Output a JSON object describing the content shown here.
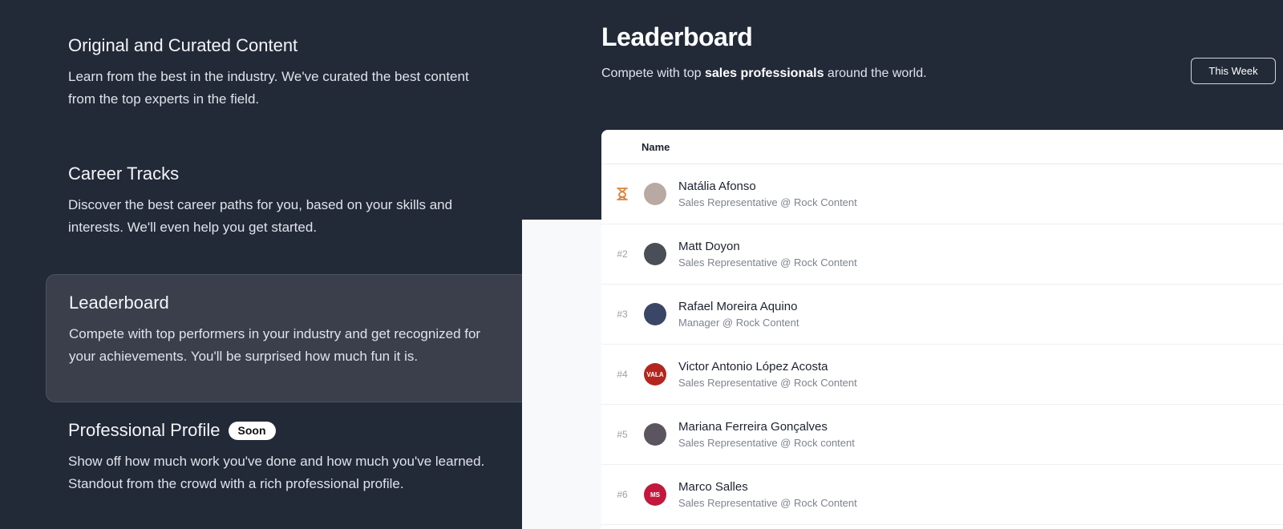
{
  "features": [
    {
      "title": "Original and Curated Content",
      "desc": "Learn from the best in the industry. We've curated the best content from the top experts in the field."
    },
    {
      "title": "Career Tracks",
      "desc": "Discover the best career paths for you, based on your skills and interests. We'll even help you get started."
    },
    {
      "title": "Leaderboard",
      "desc": "Compete with top performers in your industry and get recognized for your achievements. You'll be surprised how much fun it is."
    },
    {
      "title": "Professional Profile",
      "badge": "Soon",
      "desc": "Show off how much work you've done and how much you've learned. Standout from the crowd with a rich professional profile."
    }
  ],
  "leaderboard": {
    "title": "Leaderboard",
    "subtitle_pre": "Compete with top ",
    "subtitle_bold": "sales professionals",
    "subtitle_post": " around the world.",
    "period_button": "This Week",
    "column_name": "Name",
    "rows": [
      {
        "rank": "",
        "initials": "",
        "name": "Natália Afonso",
        "role": "Sales Representative @ Rock Content",
        "avatar_color": "#b9a9a3"
      },
      {
        "rank": "#2",
        "initials": "",
        "name": "Matt Doyon",
        "role": "Sales Representative @ Rock Content",
        "avatar_color": "#4a4f57"
      },
      {
        "rank": "#3",
        "initials": "",
        "name": "Rafael Moreira Aquino",
        "role": "Manager @ Rock Content",
        "avatar_color": "#3b4566"
      },
      {
        "rank": "#4",
        "initials": "VALA",
        "name": "Victor Antonio López Acosta",
        "role": "Sales Representative @ Rock Content",
        "avatar_color": "#b3261e"
      },
      {
        "rank": "#5",
        "initials": "",
        "name": "Mariana Ferreira Gonçalves",
        "role": "Sales Representative @ Rock content",
        "avatar_color": "#5b5560"
      },
      {
        "rank": "#6",
        "initials": "MS",
        "name": "Marco Salles",
        "role": "Sales Representative @ Rock Content",
        "avatar_color": "#c2183c"
      }
    ]
  },
  "colors": {
    "trophy": "#d9843a",
    "background": "#222a38",
    "active_card": "#3a3f4b"
  }
}
